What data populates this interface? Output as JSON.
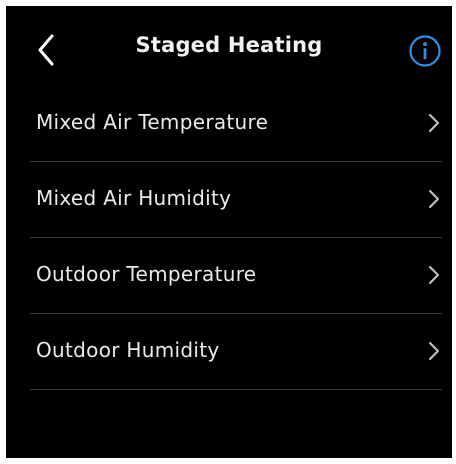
{
  "header": {
    "title": "Staged Heating",
    "back_icon": "chevron-left-icon",
    "info_icon": "info-circle-icon"
  },
  "colors": {
    "background": "#000000",
    "accent": "#2e8fe6",
    "text": "#ffffff",
    "divider": "#3a3a3a"
  },
  "list": {
    "items": [
      {
        "label": "Mixed Air Temperature"
      },
      {
        "label": "Mixed Air Humidity"
      },
      {
        "label": "Outdoor Temperature"
      },
      {
        "label": "Outdoor Humidity"
      }
    ]
  }
}
